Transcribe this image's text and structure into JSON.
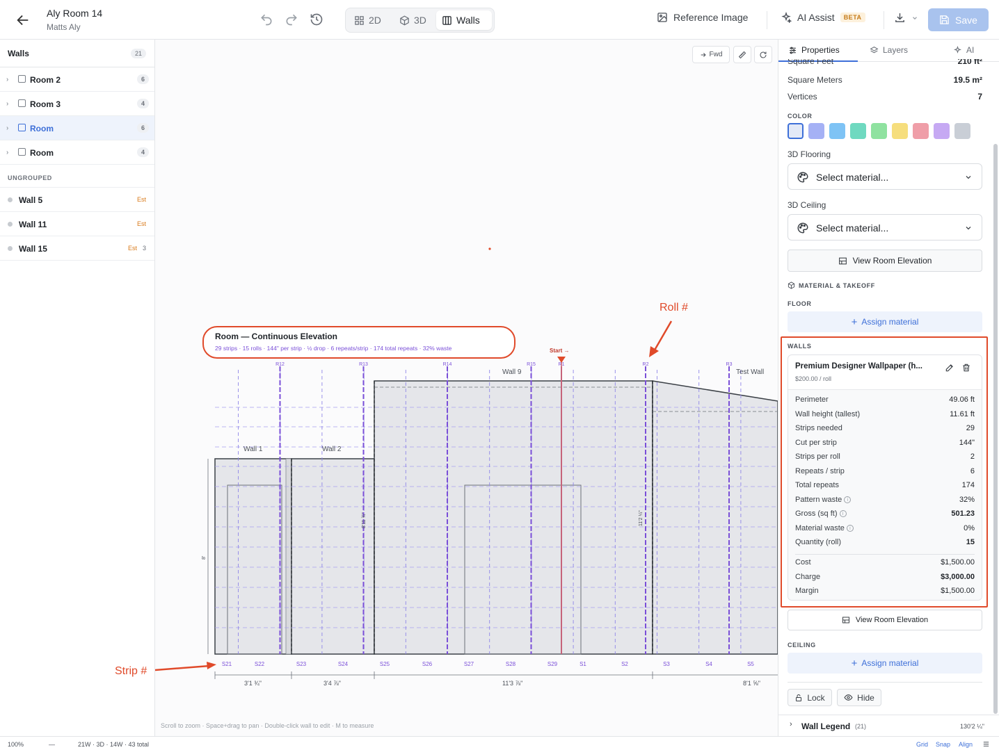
{
  "header": {
    "title": "Aly Room 14",
    "subtitle": "Matts Aly",
    "views": [
      "2D",
      "3D",
      "Walls"
    ],
    "active_view": "Walls",
    "reference_image": "Reference Image",
    "ai_assist": "AI Assist",
    "beta": "BETA",
    "save": "Save"
  },
  "left": {
    "title": "Walls",
    "count": "21",
    "groups": [
      {
        "name": "Room 2",
        "count": "6"
      },
      {
        "name": "Room 3",
        "count": "4"
      },
      {
        "name": "Room",
        "count": "6",
        "selected": true
      },
      {
        "name": "Room",
        "count": "4"
      }
    ],
    "ungrouped_label": "UNGROUPED",
    "walls": [
      {
        "name": "Wall 5",
        "est": "Est",
        "extra": ""
      },
      {
        "name": "Wall 11",
        "est": "Est",
        "extra": ""
      },
      {
        "name": "Wall 15",
        "est": "Est",
        "extra": "3"
      }
    ]
  },
  "canvas": {
    "fwd": "Fwd",
    "hint": "Scroll to zoom · Space+drag to pan · Double-click wall to edit · M to measure",
    "elevation_title": "Room — Continuous Elevation",
    "elevation_summary": "29 strips · 15 rolls · 144\" per strip · ½ drop · 6 repeats/strip · 174 total repeats · 32% waste",
    "roll_annotation": "Roll #",
    "strip_annotation": "Strip #",
    "start_label": "Start →",
    "roll_labels": [
      "R12",
      "R13",
      "R14",
      "R15",
      "R1",
      "R2",
      "R3"
    ],
    "strip_labels": [
      "S21",
      "S22",
      "S23",
      "S24",
      "S25",
      "S26",
      "S27",
      "S28",
      "S29",
      "S1",
      "S2",
      "S3",
      "S4",
      "S5"
    ],
    "wall_labels": [
      "Wall 1",
      "Wall 2",
      "Wall 9",
      "Test Wall"
    ],
    "dimensions": [
      "3'1 ¾\"",
      "3'4 ⅞\"",
      "11'3 ⅞\"",
      "8'1 ⅝\""
    ],
    "height_labels": [
      "8'",
      "11'2 ¼\"",
      "8'11 ¾\""
    ]
  },
  "right": {
    "tabs": [
      "Properties",
      "Layers",
      "AI"
    ],
    "square_feet_label": "Square Feet",
    "square_feet_value": "210 ft²",
    "square_meters_label": "Square Meters",
    "square_meters_value": "19.5 m²",
    "vertices_label": "Vertices",
    "vertices_value": "7",
    "color_label": "COLOR",
    "colors": [
      "#e3e9f7",
      "#a5b1f5",
      "#7ec3f5",
      "#6fd9c0",
      "#8fe2a0",
      "#f6de7d",
      "#ef9ea8",
      "#c6a9f3",
      "#c9ced6"
    ],
    "flooring_label": "3D Flooring",
    "flooring_value": "Select material...",
    "ceiling3d_label": "3D Ceiling",
    "ceiling3d_value": "Select material...",
    "view_elevation": "View Room Elevation",
    "material_takeoff": "MATERIAL & TAKEOFF",
    "floor_label": "FLOOR",
    "assign_material": "Assign material",
    "walls_label": "WALLS",
    "material_name": "Premium Designer Wallpaper (h...",
    "material_price": "$200.00 / roll",
    "rows": [
      {
        "label": "Perimeter",
        "value": "49.06 ft"
      },
      {
        "label": "Wall height (tallest)",
        "value": "11.61 ft"
      },
      {
        "label": "Strips needed",
        "value": "29"
      },
      {
        "label": "Cut per strip",
        "value": "144\""
      },
      {
        "label": "Strips per roll",
        "value": "2"
      },
      {
        "label": "Repeats / strip",
        "value": "6"
      },
      {
        "label": "Total repeats",
        "value": "174"
      },
      {
        "label": "Pattern waste",
        "value": "32%",
        "info": true
      },
      {
        "label": "Gross (sq ft)",
        "value": "501.23",
        "info": true,
        "bold": true
      },
      {
        "label": "Material waste",
        "value": "0%",
        "info": true
      },
      {
        "label": "Quantity (roll)",
        "value": "15",
        "bold": true
      }
    ],
    "cost_rows": [
      {
        "label": "Cost",
        "value": "$1,500.00"
      },
      {
        "label": "Charge",
        "value": "$3,000.00",
        "bold": true
      },
      {
        "label": "Margin",
        "value": "$1,500.00"
      }
    ],
    "view_elevation_2": "View Room Elevation",
    "ceiling_label": "CEILING",
    "lock": "Lock",
    "hide": "Hide",
    "legend_label": "Wall Legend",
    "legend_count": "(21)",
    "legend_total": "130'2 ¼\""
  },
  "status": {
    "zoom": "100%",
    "dash": "—",
    "summary": "21W · 3D · 14W · 43 total",
    "grid": "Grid",
    "snap": "Snap",
    "align": "Align"
  }
}
